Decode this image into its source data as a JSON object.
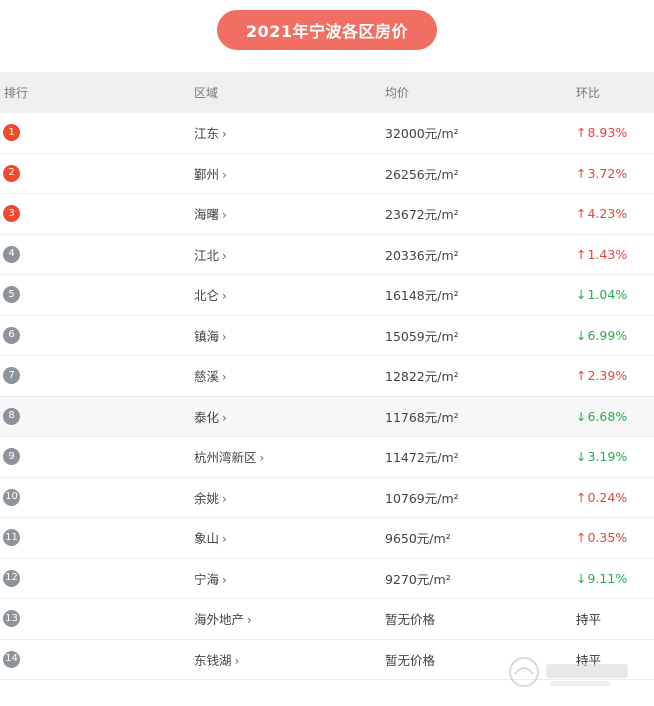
{
  "title": "2021年宁波各区房价",
  "colors": {
    "title_bg": "#f06f62",
    "rank_top": "#f04a2c",
    "rank_other": "#8c939a",
    "up": "#e6453c",
    "down": "#2bab4e"
  },
  "headers": {
    "rank": "排行",
    "region": "区域",
    "price": "均价",
    "change": "环比"
  },
  "rows": [
    {
      "rank": "1",
      "region": "江东",
      "price": "32000元/m²",
      "change": "8.93%",
      "direction": "up"
    },
    {
      "rank": "2",
      "region": "鄞州",
      "price": "26256元/m²",
      "change": "3.72%",
      "direction": "up"
    },
    {
      "rank": "3",
      "region": "海曙",
      "price": "23672元/m²",
      "change": "4.23%",
      "direction": "up"
    },
    {
      "rank": "4",
      "region": "江北",
      "price": "20336元/m²",
      "change": "1.43%",
      "direction": "up"
    },
    {
      "rank": "5",
      "region": "北仑",
      "price": "16148元/m²",
      "change": "1.04%",
      "direction": "down"
    },
    {
      "rank": "6",
      "region": "镇海",
      "price": "15059元/m²",
      "change": "6.99%",
      "direction": "down"
    },
    {
      "rank": "7",
      "region": "慈溪",
      "price": "12822元/m²",
      "change": "2.39%",
      "direction": "up"
    },
    {
      "rank": "8",
      "region": "泰化",
      "price": "11768元/m²",
      "change": "6.68%",
      "direction": "down"
    },
    {
      "rank": "9",
      "region": "杭州湾新区",
      "price": "11472元/m²",
      "change": "3.19%",
      "direction": "down"
    },
    {
      "rank": "10",
      "region": "余姚",
      "price": "10769元/m²",
      "change": "0.24%",
      "direction": "up"
    },
    {
      "rank": "11",
      "region": "象山",
      "price": "9650元/m²",
      "change": "0.35%",
      "direction": "up"
    },
    {
      "rank": "12",
      "region": "宁海",
      "price": "9270元/m²",
      "change": "9.11%",
      "direction": "down"
    },
    {
      "rank": "13",
      "region": "海外地产",
      "price": "暂无价格",
      "change": "持平",
      "direction": "flat"
    },
    {
      "rank": "14",
      "region": "东钱湖",
      "price": "暂无价格",
      "change": "持平",
      "direction": "flat"
    }
  ],
  "icons": {
    "chevron": "chevron-right-icon",
    "up": "arrow-up-icon",
    "down": "arrow-down-icon"
  }
}
